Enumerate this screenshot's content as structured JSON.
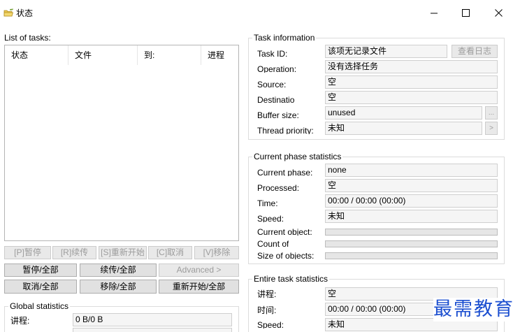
{
  "window": {
    "title": "状态",
    "icon": "folder-pen-icon",
    "controls": {
      "minimize": "minimize-icon",
      "maximize": "maximize-icon",
      "close": "close-icon"
    }
  },
  "tasks": {
    "label": "List of tasks:",
    "columns": [
      "状态",
      "文件",
      "到:",
      "进程"
    ],
    "rows": []
  },
  "task_buttons": [
    "[P]暂停",
    "[R]续传",
    "[S]重新开始",
    "[C]取消",
    "[V]移除"
  ],
  "bulk_buttons": {
    "pause_all": "暂停/全部",
    "resume_all": "续传/全部",
    "advanced": "Advanced >",
    "cancel_all": "取消/全部",
    "remove_all": "移除/全部",
    "restart_all": "重新开始/全部"
  },
  "global_stats": {
    "title": "Global statistics",
    "progress_label": "讲程:",
    "progress_value": "0 B/0 B"
  },
  "task_info": {
    "title": "Task information",
    "task_id": {
      "label": "Task ID:",
      "value": "该项无记录文件",
      "button": "查看日志"
    },
    "operation": {
      "label": "Operation:",
      "value": "没有选择任务"
    },
    "source": {
      "label": "Source:",
      "value": "空"
    },
    "destination": {
      "label": "Destinatio",
      "value": "空"
    },
    "buffer_size": {
      "label": "Buffer size:",
      "value": "unused",
      "button": "..."
    },
    "thread_priority": {
      "label": "Thread priority:",
      "value": "未知",
      "button": ">"
    }
  },
  "phase_stats": {
    "title": "Current phase statistics",
    "current_phase": {
      "label": "Current phase:",
      "value": "none"
    },
    "processed": {
      "label": "Processed:",
      "value": "空"
    },
    "time": {
      "label": "Time:",
      "value": "00:00 / 00:00 (00:00)"
    },
    "speed": {
      "label": "Speed:",
      "value": "未知"
    },
    "current_object": {
      "label": "Current object:",
      "progress": 0
    },
    "count_of": {
      "label": "Count of",
      "progress": 0
    },
    "size_of_objects": {
      "label": "Size of objects:",
      "progress": 0
    }
  },
  "entire_stats": {
    "title": "Entire task statistics",
    "progress": {
      "label": "讲程:",
      "value": "空"
    },
    "time": {
      "label": "时间:",
      "value": "00:00 / 00:00 (00:00)"
    },
    "speed": {
      "label": "Speed:",
      "value": "未知"
    }
  },
  "watermark": {
    "text": "最需教育",
    "color": "#1c4fd0"
  }
}
